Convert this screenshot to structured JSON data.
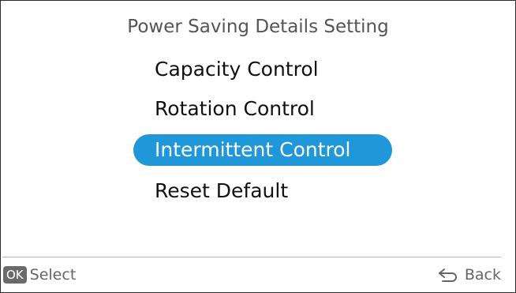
{
  "title": "Power Saving Details Setting",
  "menu": {
    "items": [
      {
        "label": "Capacity Control",
        "selected": false
      },
      {
        "label": "Rotation Control",
        "selected": false
      },
      {
        "label": "Intermittent Control",
        "selected": true
      },
      {
        "label": "Reset Default",
        "selected": false
      }
    ]
  },
  "footer": {
    "ok_badge": "OK",
    "select_label": "Select",
    "back_label": "Back",
    "back_icon": "return-arrow-icon"
  },
  "colors": {
    "selection": "#1f97d8",
    "badge": "#6a6a6a"
  }
}
